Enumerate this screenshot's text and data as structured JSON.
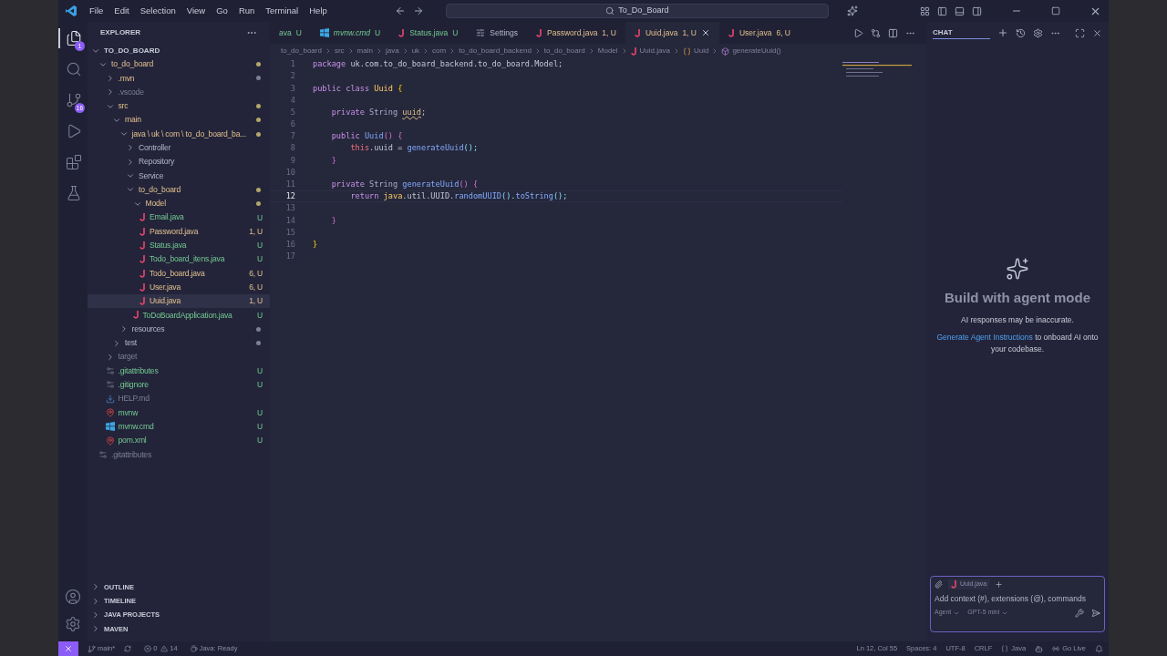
{
  "menu": [
    "File",
    "Edit",
    "Selection",
    "View",
    "Go",
    "Run",
    "Terminal",
    "Help"
  ],
  "search": {
    "value": "To_Do_Board"
  },
  "activity": [
    {
      "kind": "files",
      "selected": true,
      "badge": "1"
    },
    {
      "kind": "search",
      "selected": false
    },
    {
      "kind": "git",
      "selected": false,
      "badge": "16"
    },
    {
      "kind": "debug",
      "selected": false
    },
    {
      "kind": "extensions",
      "selected": false
    },
    {
      "kind": "testing",
      "selected": false
    }
  ],
  "explorer": {
    "title": "EXPLORER",
    "root": "TO_DO_BOARD",
    "items": [
      {
        "label": "to_do_board",
        "kind": "folder",
        "expanded": true,
        "modified": true,
        "untracked": false,
        "ignored": false,
        "color": "#b3a66a",
        "selected": false,
        "children": [
          {
            "label": ".mvn",
            "kind": "folder",
            "expanded": false,
            "modified": true,
            "untracked": false,
            "ignored": false,
            "color": "#7d8090",
            "selected": false
          },
          {
            "label": ".vscode",
            "kind": "folder",
            "expanded": false,
            "modified": false,
            "untracked": false,
            "ignored": true,
            "selected": false
          },
          {
            "label": "src",
            "kind": "folder",
            "expanded": true,
            "modified": true,
            "untracked": false,
            "ignored": false,
            "color": "#b3a66a",
            "selected": false,
            "children": [
              {
                "label": "main",
                "kind": "folder",
                "expanded": true,
                "modified": true,
                "untracked": false,
                "ignored": false,
                "color": "#b3a66a",
                "selected": false,
                "children": [
                  {
                    "label": "java \\ uk \\ com \\ to_do_board_ba...",
                    "kind": "folder",
                    "expanded": true,
                    "modified": true,
                    "untracked": false,
                    "ignored": false,
                    "color": "#b3a66a",
                    "selected": false,
                    "children": [
                      {
                        "label": "Controller",
                        "kind": "folder",
                        "expanded": false,
                        "modified": false,
                        "untracked": false,
                        "ignored": false,
                        "selected": false
                      },
                      {
                        "label": "Repository",
                        "kind": "folder",
                        "expanded": false,
                        "modified": false,
                        "untracked": false,
                        "ignored": false,
                        "selected": false
                      },
                      {
                        "label": "Service",
                        "kind": "folder",
                        "expanded": true,
                        "modified": false,
                        "untracked": false,
                        "ignored": false,
                        "selected": false
                      },
                      {
                        "label": "to_do_board",
                        "kind": "folder",
                        "expanded": true,
                        "modified": true,
                        "untracked": false,
                        "ignored": false,
                        "color": "#b3a66a",
                        "selected": false,
                        "children": [
                          {
                            "label": "Model",
                            "kind": "folder",
                            "expanded": true,
                            "modified": true,
                            "untracked": false,
                            "ignored": false,
                            "color": "#b3a66a",
                            "selected": false,
                            "children": [
                              {
                                "label": "Email.java",
                                "kind": "java",
                                "modified": false,
                                "untracked": true,
                                "ignored": false,
                                "badge": "U",
                                "selected": false
                              },
                              {
                                "label": "Password.java",
                                "kind": "java",
                                "modified": true,
                                "untracked": false,
                                "ignored": false,
                                "badge": "1, U",
                                "selected": false
                              },
                              {
                                "label": "Status.java",
                                "kind": "java",
                                "modified": false,
                                "untracked": true,
                                "ignored": false,
                                "badge": "U",
                                "selected": false
                              },
                              {
                                "label": "Todo_board_itens.java",
                                "kind": "java",
                                "modified": false,
                                "untracked": true,
                                "ignored": false,
                                "badge": "U",
                                "selected": false
                              },
                              {
                                "label": "Todo_board.java",
                                "kind": "java",
                                "modified": true,
                                "untracked": false,
                                "ignored": false,
                                "badge": "6, U",
                                "selected": false
                              },
                              {
                                "label": "User.java",
                                "kind": "java",
                                "modified": true,
                                "untracked": false,
                                "ignored": false,
                                "badge": "6, U",
                                "selected": false
                              },
                              {
                                "label": "Uuid.java",
                                "kind": "java",
                                "modified": true,
                                "untracked": false,
                                "ignored": false,
                                "badge": "1, U",
                                "selected": true
                              }
                            ]
                          },
                          {
                            "label": "ToDoBoardApplication.java",
                            "kind": "java",
                            "modified": false,
                            "untracked": true,
                            "ignored": false,
                            "badge": "U",
                            "selected": false
                          }
                        ]
                      }
                    ]
                  },
                  {
                    "label": "resources",
                    "kind": "folder",
                    "expanded": false,
                    "modified": false,
                    "untracked": false,
                    "ignored": false,
                    "color": "#7d8090",
                    "selected": false
                  }
                ]
              },
              {
                "label": "test",
                "kind": "folder",
                "expanded": false,
                "modified": false,
                "untracked": false,
                "ignored": false,
                "color": "#7d8090",
                "selected": false
              }
            ]
          },
          {
            "label": "target",
            "kind": "folder",
            "expanded": false,
            "modified": false,
            "untracked": false,
            "ignored": true,
            "selected": false
          },
          {
            "label": ".gitattributes",
            "kind": "config",
            "modified": false,
            "untracked": true,
            "ignored": false,
            "badge": "U",
            "selected": false
          },
          {
            "label": ".gitignore",
            "kind": "config",
            "modified": false,
            "untracked": true,
            "ignored": false,
            "badge": "U",
            "selected": false
          },
          {
            "label": "HELP.md",
            "kind": "markdown",
            "modified": false,
            "untracked": false,
            "ignored": true,
            "selected": false
          },
          {
            "label": "mvnw",
            "kind": "pin",
            "modified": false,
            "untracked": true,
            "ignored": false,
            "badge": "U",
            "selected": false
          },
          {
            "label": "mvnw.cmd",
            "kind": "windows",
            "modified": false,
            "untracked": true,
            "ignored": false,
            "badge": "U",
            "selected": false
          },
          {
            "label": "pom.xml",
            "kind": "pin",
            "modified": false,
            "untracked": true,
            "ignored": false,
            "badge": "U",
            "selected": false
          }
        ]
      },
      {
        "label": ".gitattributes",
        "kind": "config",
        "modified": false,
        "untracked": false,
        "ignored": true,
        "selected": false
      }
    ]
  },
  "panels": [
    "OUTLINE",
    "TIMELINE",
    "JAVA PROJECTS",
    "MAVEN"
  ],
  "tabs": [
    {
      "label": "ava",
      "badge": "U",
      "kind": "partial",
      "modified": false,
      "untracked": true,
      "preview": false,
      "selected": false
    },
    {
      "label": "mvnw.cmd",
      "badge": "U",
      "kind": "windows",
      "modified": false,
      "untracked": true,
      "preview": true,
      "selected": false
    },
    {
      "label": "Status.java",
      "badge": "U",
      "kind": "java",
      "modified": false,
      "untracked": true,
      "preview": false,
      "selected": false
    },
    {
      "label": "Settings",
      "kind": "settings",
      "modified": false,
      "untracked": false,
      "preview": false,
      "selected": false
    },
    {
      "label": "Password.java",
      "badge": "1, U",
      "kind": "java",
      "modified": true,
      "untracked": false,
      "preview": false,
      "selected": false
    },
    {
      "label": "Uuid.java",
      "badge": "1, U",
      "kind": "java",
      "modified": true,
      "untracked": false,
      "preview": false,
      "selected": true
    },
    {
      "label": "User.java",
      "badge": "6, U",
      "kind": "java",
      "modified": true,
      "untracked": false,
      "preview": false,
      "selected": false
    }
  ],
  "breadcrumbs": [
    {
      "label": "to_do_board",
      "kind": "folder"
    },
    {
      "label": "src",
      "kind": "folder"
    },
    {
      "label": "main",
      "kind": "folder"
    },
    {
      "label": "java",
      "kind": "folder"
    },
    {
      "label": "uk",
      "kind": "folder"
    },
    {
      "label": "com",
      "kind": "folder"
    },
    {
      "label": "to_do_board_backend",
      "kind": "folder"
    },
    {
      "label": "to_do_board",
      "kind": "folder"
    },
    {
      "label": "Model",
      "kind": "folder"
    },
    {
      "label": "Uuid.java",
      "kind": "file"
    },
    {
      "label": "Uuid",
      "kind": "class"
    },
    {
      "label": "generateUuid()",
      "kind": "method"
    }
  ],
  "code": [
    {
      "n": "1",
      "current": false,
      "tokens": [
        {
          "t": "package ",
          "kind": "kw"
        },
        {
          "t": "uk.com.to_do_board_backend.to_do_board.Model;",
          "kind": "plain"
        }
      ]
    },
    {
      "n": "2",
      "current": false
    },
    {
      "n": "3",
      "current": false,
      "tokens": [
        {
          "t": "public class ",
          "kind": "kw"
        },
        {
          "t": "Uuid ",
          "kind": "cls"
        },
        {
          "t": "{",
          "kind": "brace"
        }
      ]
    },
    {
      "n": "4",
      "current": false
    },
    {
      "n": "5",
      "current": false,
      "tokens": [
        {
          "t": "    private ",
          "kind": "kw"
        },
        {
          "t": "String ",
          "kind": "type"
        },
        {
          "t": "uuid",
          "kind": "var",
          "warning": true
        },
        {
          "t": ";",
          "kind": "plain"
        }
      ]
    },
    {
      "n": "6",
      "current": false
    },
    {
      "n": "7",
      "current": false,
      "tokens": [
        {
          "t": "    public ",
          "kind": "kw"
        },
        {
          "t": "Uuid",
          "kind": "fn"
        },
        {
          "t": "() {",
          "kind": "brace2"
        }
      ]
    },
    {
      "n": "8",
      "current": false,
      "tokens": [
        {
          "t": "        this",
          "kind": "this"
        },
        {
          "t": ".uuid = ",
          "kind": "plain"
        },
        {
          "t": "generateUuid",
          "kind": "fn"
        },
        {
          "t": "();",
          "kind": "punct"
        }
      ]
    },
    {
      "n": "9",
      "current": false,
      "tokens": [
        {
          "t": "    }",
          "kind": "brace2"
        }
      ]
    },
    {
      "n": "10",
      "current": false
    },
    {
      "n": "11",
      "current": false,
      "tokens": [
        {
          "t": "    private ",
          "kind": "kw"
        },
        {
          "t": "String ",
          "kind": "type"
        },
        {
          "t": "generateUuid",
          "kind": "fn"
        },
        {
          "t": "() {",
          "kind": "brace2"
        }
      ]
    },
    {
      "n": "12",
      "current": true,
      "tokens": [
        {
          "t": "        return ",
          "kind": "kw"
        },
        {
          "t": "java",
          "kind": "cls"
        },
        {
          "t": ".util.UUID.",
          "kind": "plain"
        },
        {
          "t": "randomUUID",
          "kind": "fn"
        },
        {
          "t": "().",
          "kind": "punct"
        },
        {
          "t": "toString",
          "kind": "fn"
        },
        {
          "t": "();",
          "kind": "punct"
        }
      ]
    },
    {
      "n": "13",
      "current": false
    },
    {
      "n": "14",
      "current": false,
      "tokens": [
        {
          "t": "    }",
          "kind": "brace2"
        }
      ]
    },
    {
      "n": "15",
      "current": false
    },
    {
      "n": "16",
      "current": false,
      "tokens": [
        {
          "t": "}",
          "kind": "brace"
        }
      ]
    },
    {
      "n": "17",
      "current": false
    }
  ],
  "chat": {
    "title": "CHAT",
    "heading": "Build with agent mode",
    "note": "AI responses may be inaccurate.",
    "link": "Generate Agent Instructions",
    "link_rest": " to onboard AI onto your codebase.",
    "attachment": "Uuid.java",
    "placeholder": "Add context (#), extensions (@), commands",
    "mode": "Agent",
    "model": "GPT-5 mini"
  },
  "status_bar": {
    "branch": "main*",
    "errors": "0",
    "warnings": "14",
    "java": "Java: Ready",
    "right": [
      "Ln 12, Col 55",
      "Spaces: 4",
      "UTF-8",
      "CRLF"
    ],
    "language": "Java",
    "live": "Go Live"
  }
}
